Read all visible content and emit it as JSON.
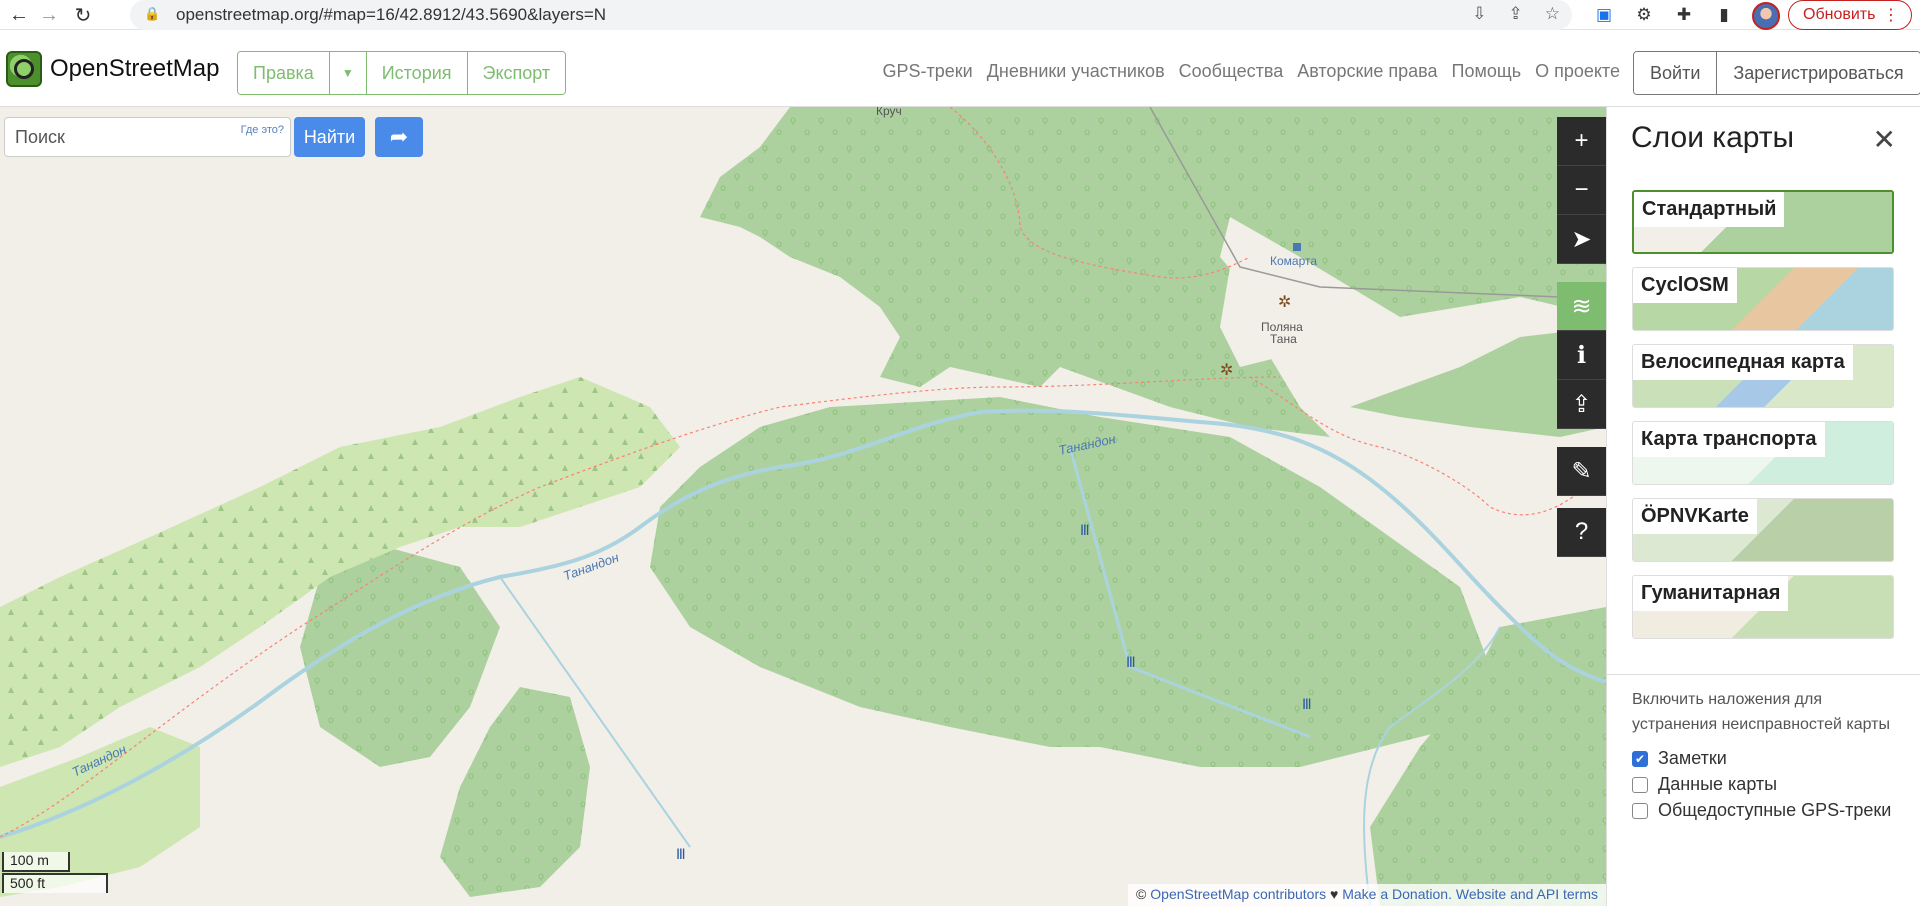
{
  "browser": {
    "url": "openstreetmap.org/#map=16/42.8912/43.5690&layers=N",
    "update_label": "Обновить",
    "update_menu": "⋮"
  },
  "header": {
    "logo_text": "OpenStreetMap",
    "edit_label": "Правка",
    "history_label": "История",
    "export_label": "Экспорт",
    "nav": [
      "GPS-треки",
      "Дневники участников",
      "Сообщества",
      "Авторские права",
      "Помощь",
      "О проекте"
    ],
    "login_label": "Войти",
    "signup_label": "Зарегистрироваться"
  },
  "search": {
    "placeholder": "Поиск",
    "where_label": "Где это?",
    "find_label": "Найти"
  },
  "map": {
    "labels": {
      "river_1": "Танандон",
      "river_2": "Танандон",
      "river_3": "Танандон",
      "village": "Комарта",
      "glade_1": "Поляна",
      "glade_2": "Тана",
      "top": "Круч"
    },
    "scale_m": "100 m",
    "scale_ft": "500 ft",
    "attribution": {
      "copy": "©",
      "contributors": "OpenStreetMap contributors",
      "heart": "♥",
      "donation": "Make a Donation.",
      "terms": "Website and API terms"
    }
  },
  "panel": {
    "title": "Слои карты",
    "layers": [
      {
        "name": "Стандартный",
        "selected": true
      },
      {
        "name": "CyclOSM",
        "selected": false
      },
      {
        "name": "Велосипедная карта",
        "selected": false
      },
      {
        "name": "Карта транспорта",
        "selected": false
      },
      {
        "name": "ÖPNVKarte",
        "selected": false
      },
      {
        "name": "Гуманитарная",
        "selected": false
      }
    ],
    "overlay_description": "Включить наложения для устранения неисправностей карты",
    "overlays": [
      {
        "label": "Заметки",
        "checked": true
      },
      {
        "label": "Данные карты",
        "checked": false
      },
      {
        "label": "Общедоступные GPS-треки",
        "checked": false
      }
    ]
  },
  "colors": {
    "osm_green": "#7ebc6f",
    "forest": "#add19e",
    "meadow": "#cdebb0",
    "water": "#aad3df",
    "land": "#f2efe9",
    "control": "#2b2b2b",
    "link": "#3b67b4"
  }
}
